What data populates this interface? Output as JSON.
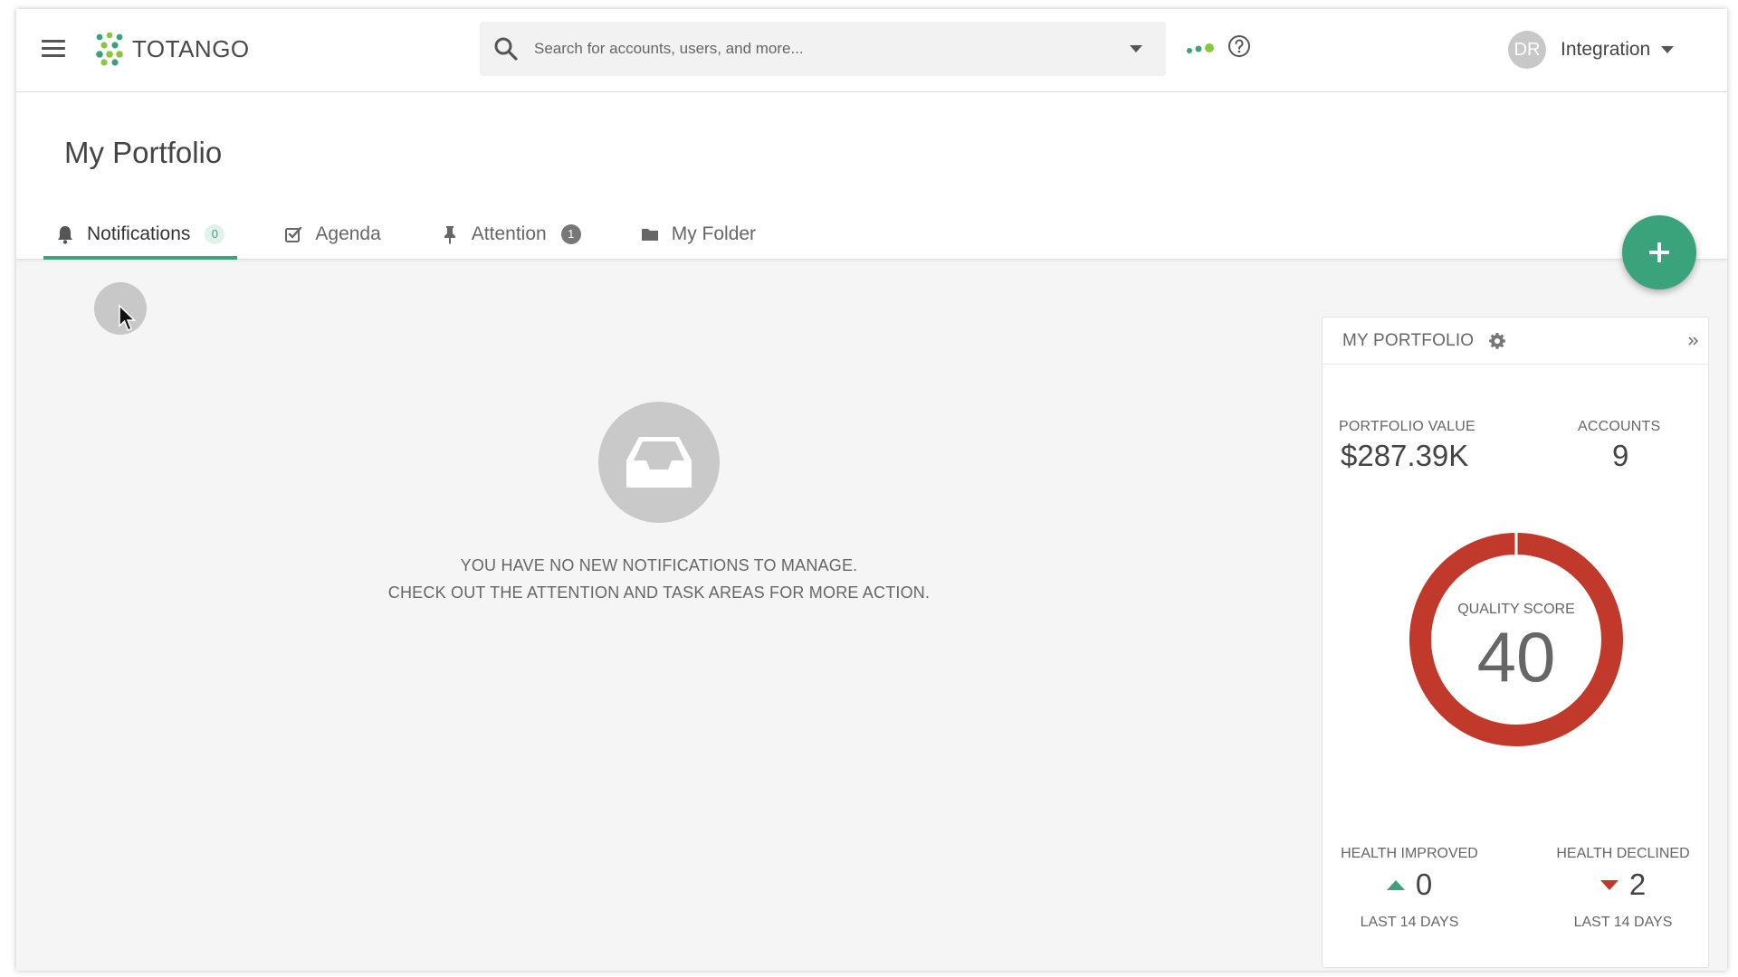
{
  "header": {
    "brand": "TOTANGO",
    "search_placeholder": "Search for accounts, users, and more...",
    "user": {
      "initials": "DR",
      "name": "Integration"
    }
  },
  "page": {
    "title": "My Portfolio",
    "tabs": [
      {
        "label": "Notifications",
        "icon": "bell-icon",
        "badge": "0",
        "active": true
      },
      {
        "label": "Agenda",
        "icon": "checkbox-icon",
        "badge": "",
        "active": false
      },
      {
        "label": "Attention",
        "icon": "pin-icon",
        "badge": "1",
        "active": false
      },
      {
        "label": "My Folder",
        "icon": "folder-icon",
        "badge": "",
        "active": false
      }
    ]
  },
  "empty_state": {
    "icon": "inbox-icon",
    "line1": "YOU HAVE NO NEW NOTIFICATIONS TO MANAGE.",
    "line2": "CHECK OUT THE ATTENTION AND TASK AREAS FOR MORE ACTION."
  },
  "portfolio_card": {
    "title": "MY PORTFOLIO",
    "portfolio_value_label": "PORTFOLIO VALUE",
    "portfolio_value": "$287.39K",
    "accounts_label": "ACCOUNTS",
    "accounts": "9",
    "quality_label": "QUALITY SCORE",
    "quality_score": "40",
    "health_improved_label": "HEALTH IMPROVED",
    "health_improved": "0",
    "health_declined_label": "HEALTH DECLINED",
    "health_declined": "2",
    "period_label": "LAST 14 DAYS"
  },
  "colors": {
    "accent": "#3aa37b",
    "declined": "#c0392b",
    "donut": "#c0392b"
  }
}
